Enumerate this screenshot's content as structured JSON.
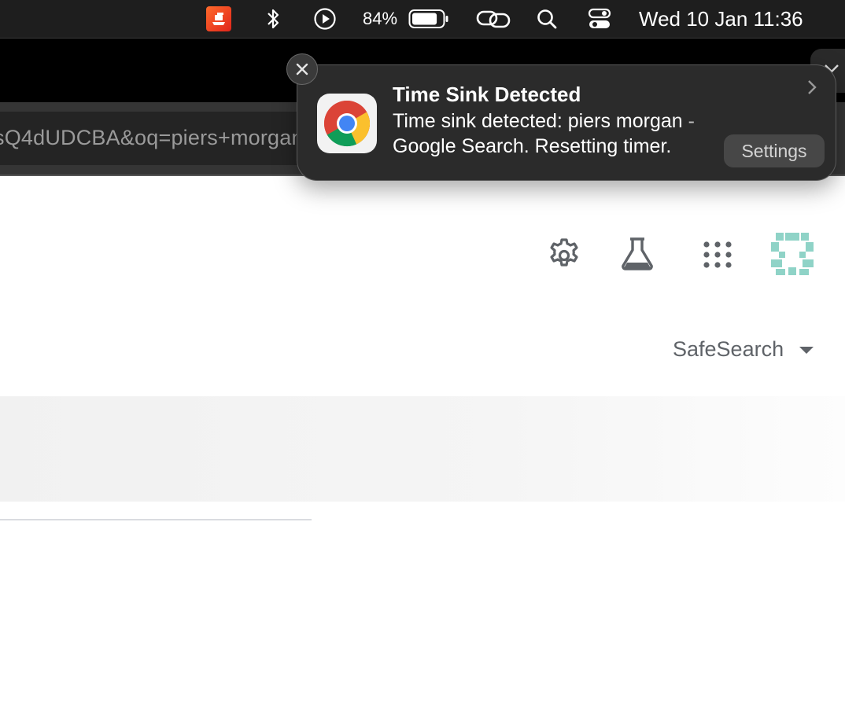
{
  "menubar": {
    "battery_percent_label": "84%",
    "battery_level": 0.84,
    "datetime": "Wed 10 Jan  11:36",
    "icons": [
      "app-extension-icon",
      "bluetooth-icon",
      "play-icon",
      "battery-icon",
      "link-icon",
      "search-icon",
      "control-center-icon"
    ]
  },
  "browser": {
    "omnibox_text": "sQ4dUDCBA&oq=piers+morgan"
  },
  "notification": {
    "title": "Time Sink Detected",
    "body_line1": "Time sink detected: piers morgan -",
    "body_line2": "Google Search. Resetting timer.",
    "settings_label": "Settings",
    "app_icon": "chrome-icon"
  },
  "page": {
    "safesearch_label": "SafeSearch",
    "header_icons": [
      "settings-icon",
      "labs-icon",
      "apps-grid-icon",
      "avatar"
    ],
    "avatar_color": "#8fd3c7"
  }
}
